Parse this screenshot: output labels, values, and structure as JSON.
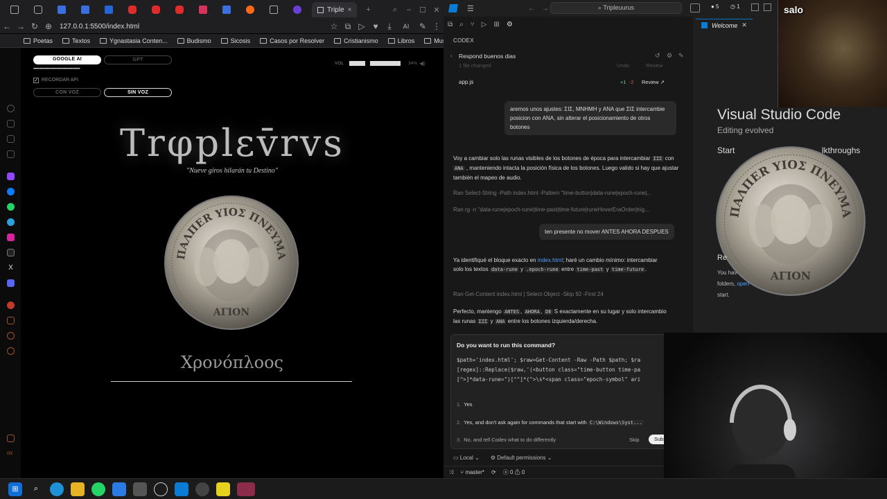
{
  "browser": {
    "active_tab_label": "Triple",
    "url": "127.0.0.1:5500/index.html",
    "bookmarks": [
      "Poetas",
      "Textos",
      "Ygnastasia Conten...",
      "Budismo",
      "Sicosis",
      "Casos por Resolver",
      "Cristianismo",
      "Libros",
      "Musica"
    ]
  },
  "page": {
    "btn_google": "GOOGLE AI",
    "btn_gpt": "GPT",
    "api_key_mask": "••••••••••••••••••••••••••••••••••••••••••",
    "remember_api": "RECORDAR API",
    "btn_con_voz": "CON VOZ",
    "btn_sin_voz": "SIN VOZ",
    "vol_label": "VOL",
    "vol_percent": "34%",
    "vol_level": 0.34,
    "title": "Trφplεv̄rvs",
    "subtitle": "\"Nueve giros hilarán tu Destino\"",
    "coin_top": "ΠΑΛΠΕR ΥΙΟΣ ΠΝΕΥΜΑ",
    "coin_bottom": "ΑΓΙΟΝ",
    "bottom_word": "Χρονόπλοος"
  },
  "vscode": {
    "search": "Tripleuurus",
    "codex_label": "CODEX",
    "conversation": "Respond buenos dias",
    "files_changed": "1 file changed",
    "undo": "Undo",
    "review": "Review",
    "file_name": "app.js",
    "file_diff_add": "+1",
    "file_diff_del": "-2",
    "file_review": "Review ↗",
    "user_msg_1": "aremos unos ajustes:  ΣΙΣ, ΜΝΗΜΗ y ΑΝΑ que ΣΙΣ intercambie posicion con ΑΝΑ, sin alterar el posicionamiento de otros botones",
    "assistant_1_a": "Voy a cambiar solo las runas visibles de los botones de época para intercambiar",
    "assistant_1_code1": "ΣΙΣ",
    "assistant_1_b": "con",
    "assistant_1_code2": "ΑΝΑ",
    "assistant_1_c": ", manteniendo intacta la posición física de los botones. Luego valido si hay que ajustar también el mapeo de audio.",
    "ran_1": "Ran Select-String -Path index.html -Pattern \"time-button|data-rune|epoch-rune|...",
    "ran_2": "Ran rg -n \"data-rune|epoch-rune|time-past|time-future|runeHoverEraOrder|trig...",
    "user_msg_2": "ten presente no mover ANTES AHORA DESPUES",
    "assistant_2_a": "Ya identifiqué el bloque exacto en",
    "assistant_2_link": "index.html",
    "assistant_2_b": "; haré un cambio mínimo: intercambiar solo los textos",
    "assistant_2_code1": "data-rune",
    "assistant_2_c": "y",
    "assistant_2_code2": ".epoch-rune",
    "assistant_2_d": "entre",
    "assistant_2_code3": "time-past",
    "assistant_2_e": "y",
    "assistant_2_code4": "time-future",
    "ran_3": "Ran Get-Content index.html | Select-Object -Skip 92 -First 24",
    "assistant_3_a": "Perfecto, mantengo",
    "assistant_3_code1": "ANTES",
    "assistant_3_code2": "AHORA",
    "assistant_3_code3": "DE",
    "assistant_3_b": "S exactamente en su lugar y solo intercambio las runas",
    "assistant_3_code4": "ΣΙΣ",
    "assistant_3_c": "y",
    "assistant_3_code5": "ΑΝΑ",
    "assistant_3_d": "entre los botones izquierda/derecha.",
    "cmd_question": "Do you want to run this command?",
    "cmd_line_1": "$path='index.html'; $raw=Get-Content -Raw -Path $path; $ra",
    "cmd_line_2": "[regex]::Replace($raw,'(<button class=\"time-button time-pa",
    "cmd_line_3": "[^>]*data-rune=\")[^\"]*(\">\\s*<span class=\"epoch-symbol\" ari",
    "opt_1": "Yes",
    "opt_2": "Yes, and don't ask again for commands that start with",
    "opt_2_code": "C:\\Windows\\Syst...",
    "opt_3": "No, and tell Codex what to do differently",
    "skip": "Skip",
    "submit": "Subm",
    "footer_local": "Local",
    "footer_perm": "Default permissions",
    "status_branch": "master*",
    "status_errors": "0",
    "status_warnings": "0",
    "welcome_tab": "Welcome",
    "welcome_title": "Visual Studio Code",
    "welcome_sub": "Editing evolved",
    "welcome_start": "Start",
    "welcome_walk": "lkthroughs",
    "welcome_recent": "Re",
    "welcome_recent_text_1": "You hav",
    "welcome_recent_text_2": "folders,",
    "welcome_recent_link": "open",
    "welcome_recent_text_3": "start."
  },
  "overlay": {
    "streamer_name": "salo"
  },
  "colors": {
    "accent_blue": "#0078d4",
    "link_blue": "#4ea1ff",
    "diff_add": "#73c991",
    "diff_del": "#e05252"
  }
}
